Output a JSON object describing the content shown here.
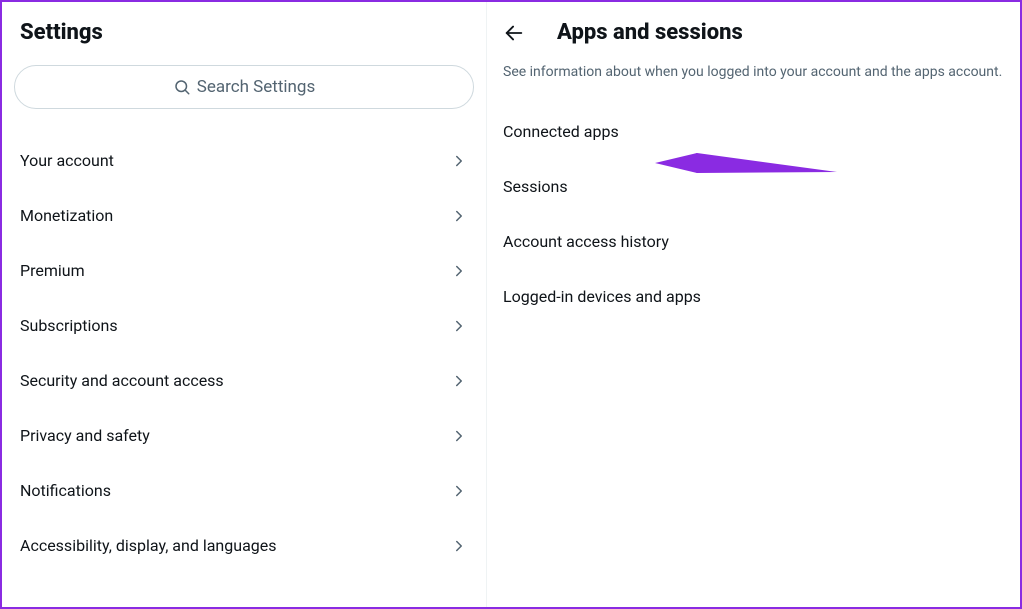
{
  "left": {
    "title": "Settings",
    "search_placeholder": "Search Settings",
    "items": [
      {
        "label": "Your account"
      },
      {
        "label": "Monetization"
      },
      {
        "label": "Premium"
      },
      {
        "label": "Subscriptions"
      },
      {
        "label": "Security and account access"
      },
      {
        "label": "Privacy and safety"
      },
      {
        "label": "Notifications"
      },
      {
        "label": "Accessibility, display, and languages"
      }
    ]
  },
  "right": {
    "title": "Apps and sessions",
    "description": "See information about when you logged into your account and the apps account.",
    "items": [
      {
        "label": "Connected apps"
      },
      {
        "label": "Sessions"
      },
      {
        "label": "Account access history"
      },
      {
        "label": "Logged-in devices and apps"
      }
    ]
  },
  "colors": {
    "annotation": "#8a2be2"
  }
}
